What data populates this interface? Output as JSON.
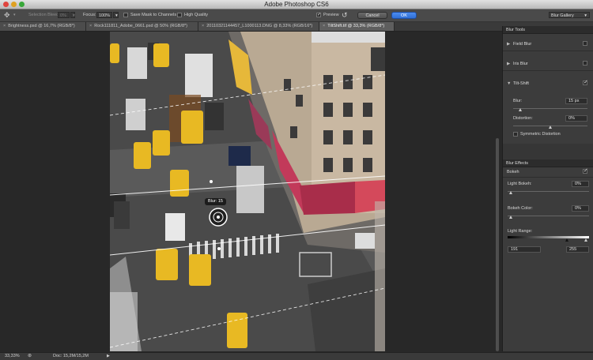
{
  "window": {
    "title": "Adobe Photoshop CS6"
  },
  "options_bar": {
    "selection_bleed_label": "Selection Bleed:",
    "selection_bleed_value": "0%",
    "focus_label": "Focus:",
    "focus_value": "100%",
    "save_mask_label": "Save Mask to Channels",
    "high_quality_label": "High Quality",
    "preview_label": "Preview",
    "preview_checked": true,
    "cancel_label": "Cancel",
    "ok_label": "OK",
    "workspace_label": "Blur Gallery"
  },
  "tabs": [
    {
      "label": "Brightness.psd @ 16,7% (RGB/8*)",
      "active": false
    },
    {
      "label": "Rock111811_Adobe_0661.psd @ 50% (RGB/8*)",
      "active": false
    },
    {
      "label": "20110321144457_L1000113.DNG @ 8,33% (RGB/16*)",
      "active": false
    },
    {
      "label": "TiltShift.tif @ 33,3% (RGB/8*)",
      "active": true
    }
  ],
  "canvas": {
    "blur_pin_label": "Blur: 15"
  },
  "blur_tools": {
    "header": "Blur Tools",
    "items": [
      {
        "label": "Field Blur",
        "expanded": false,
        "checked": false
      },
      {
        "label": "Iris Blur",
        "expanded": false,
        "checked": false
      },
      {
        "label": "Tilt-Shift",
        "expanded": true,
        "checked": true
      }
    ],
    "tilt_shift": {
      "blur_label": "Blur:",
      "blur_value": "15 px",
      "blur_level": 0.1,
      "distortion_label": "Distortion:",
      "distortion_value": "0%",
      "distortion_level": 0.5,
      "symmetric_label": "Symmetric Distortion",
      "symmetric_checked": false
    }
  },
  "blur_effects": {
    "header": "Blur Effects",
    "bokeh_label": "Bokeh",
    "bokeh_checked": true,
    "light_bokeh_label": "Light Bokeh:",
    "light_bokeh_value": "0%",
    "bokeh_color_label": "Bokeh Color:",
    "bokeh_color_value": "0%",
    "light_range_label": "Light Range:",
    "light_range_min": "191",
    "light_range_max": "255"
  },
  "status_bar": {
    "zoom": "33,33%",
    "doc_info": "Doc: 15,2M/15,2M"
  },
  "colors": {
    "panel_bg": "#3c3c3c",
    "ok_button": "#2f6fd6",
    "taxi_yellow": "#e8b923",
    "awning_pink": "#c23a5a"
  }
}
